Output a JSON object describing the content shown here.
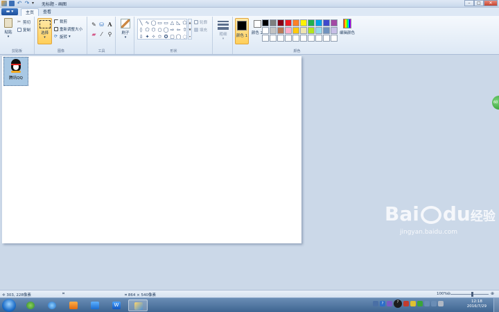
{
  "window": {
    "title": "无标题 - 画图",
    "min": "–",
    "max": "□",
    "close": "✕"
  },
  "tabs": [
    {
      "label": "主页"
    },
    {
      "label": "查看"
    }
  ],
  "file_menu": "▬ ▾",
  "ribbon": {
    "clipboard": {
      "label": "剪贴板",
      "paste": "粘贴",
      "cut": "剪切",
      "copy": "复制"
    },
    "image": {
      "label": "图像",
      "select": "选择",
      "crop": "裁剪",
      "resize": "重新调整大小",
      "rotate": "旋转"
    },
    "tools": {
      "label": "工具",
      "text_glyph": "A"
    },
    "brushes": {
      "label": "刷子"
    },
    "shapes": {
      "label": "形状",
      "outline": "轮廓",
      "fill": "填充",
      "glyphs": [
        "╲",
        "∿",
        "◯",
        "▭",
        "▭",
        "△",
        "◺",
        "⬠",
        "◊",
        "⬠",
        "⬡",
        "○",
        "◯",
        "⇨",
        "⇦",
        "⇧",
        "⇩",
        "✦",
        "✧",
        "✩",
        "✪",
        "▢",
        "◯",
        "◌"
      ]
    },
    "size": {
      "label": "粗细"
    },
    "colors": {
      "label": "颜色",
      "color1": "颜色 1",
      "color2": "颜色 2",
      "edit": "编辑颜色",
      "color1_value": "#000000",
      "color2_value": "#ffffff",
      "palette": [
        "#000000",
        "#7f7f7f",
        "#880015",
        "#ed1c24",
        "#ff7f27",
        "#fff200",
        "#22b14c",
        "#00a2e8",
        "#3f48cc",
        "#a349a4",
        "#ffffff",
        "#c3c3c3",
        "#b97a57",
        "#ffaec9",
        "#ffc90e",
        "#efe4b0",
        "#b5e61d",
        "#99d9ea",
        "#7092be",
        "#c8bfe7",
        "#ffffff",
        "#ffffff",
        "#ffffff",
        "#ffffff",
        "#ffffff",
        "#ffffff",
        "#ffffff",
        "#ffffff",
        "#ffffff",
        "#ffffff"
      ]
    }
  },
  "canvas": {
    "desktop_icon_label": "腾讯QQ"
  },
  "green_widget": "60",
  "watermark": {
    "brand_a": "Bai",
    "brand_b": "du",
    "brand_cn": "经验",
    "url": "jingyan.baidu.com"
  },
  "status": {
    "cursor_pos": "303, 228像素",
    "canvas_size": "864 × 540像素",
    "zoom": "100%"
  },
  "taskbar": {
    "clock_time": "12:18",
    "clock_date": "2016/7/29"
  }
}
